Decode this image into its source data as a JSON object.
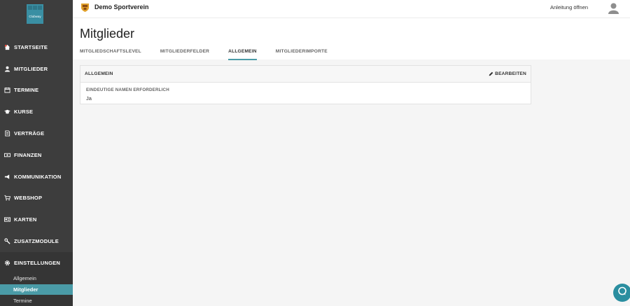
{
  "sidebar": {
    "logo_text": "Clubway",
    "items": [
      {
        "label": "STARTSEITE",
        "icon": "home-icon"
      },
      {
        "label": "MITGLIEDER",
        "icon": "user-icon"
      },
      {
        "label": "TERMINE",
        "icon": "calendar-icon"
      },
      {
        "label": "KURSE",
        "icon": "graduation-icon"
      },
      {
        "label": "VERTRÄGE",
        "icon": "document-icon"
      },
      {
        "label": "FINANZEN",
        "icon": "money-icon"
      },
      {
        "label": "KOMMUNIKATION",
        "icon": "megaphone-icon"
      },
      {
        "label": "WEBSHOP",
        "icon": "cart-icon"
      },
      {
        "label": "KARTEN",
        "icon": "card-icon"
      },
      {
        "label": "ZUSATZMODULE",
        "icon": "wrench-icon"
      },
      {
        "label": "EINSTELLUNGEN",
        "icon": "gear-icon"
      }
    ],
    "sub_items": [
      {
        "label": "Allgemein"
      },
      {
        "label": "Mitglieder",
        "active": true
      },
      {
        "label": "Termine"
      }
    ]
  },
  "topbar": {
    "club_name": "Demo Sportverein",
    "guide_link": "Anleitung öffnen"
  },
  "main": {
    "title": "Mitglieder",
    "tabs": [
      {
        "label": "MITGLIEDSCHAFTSLEVEL"
      },
      {
        "label": "MITGLIEDERFELDER"
      },
      {
        "label": "ALLGEMEIN",
        "active": true
      },
      {
        "label": "MITGLIEDERIMPORTE"
      }
    ],
    "card": {
      "title": "ALLGEMEIN",
      "edit_label": "BEARBEITEN",
      "field_label": "EINDEUTIGE NAMEN ERFORDERLICH",
      "field_value": "Ja"
    }
  },
  "colors": {
    "sidebar_bg": "#3d3d3d",
    "accent": "#4a9ba7",
    "chat_button": "#2a8ea0"
  }
}
